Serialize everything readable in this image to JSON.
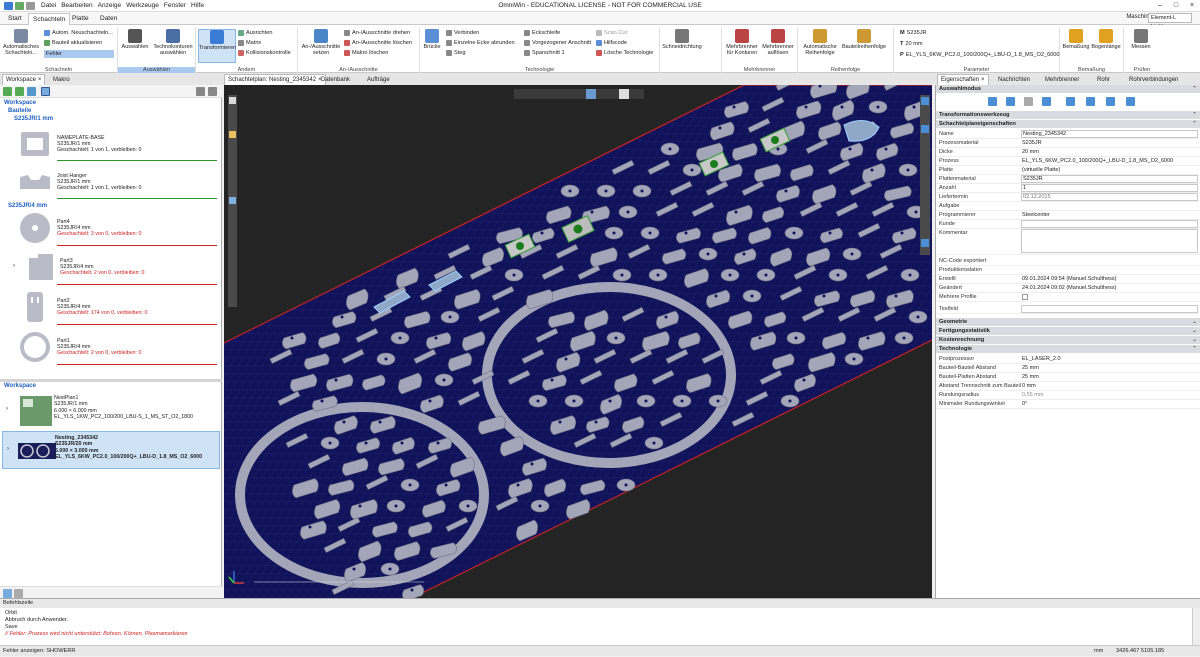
{
  "title_bar": {
    "menu": [
      "Datei",
      "Bearbeiten",
      "Anzeige",
      "Werkzeuge",
      "Fenster",
      "Hilfe"
    ],
    "title": "OmniWin - EDUCATIONAL LICENSE - NOT FOR COMMERCIAL USE",
    "controls": [
      "–",
      "□",
      "×"
    ]
  },
  "ribbon_tabs": [
    "Start",
    "Schachteln",
    "Platte",
    "Daten"
  ],
  "machine": {
    "label": "Maschine",
    "value": "Element-L Liebherr"
  },
  "ribbon": {
    "schachteln": {
      "big": "Automatisches Schachteln...",
      "items": [
        "Autom. Neuschachteln...",
        "Bauteil aktualisieren",
        "Fehler"
      ],
      "group": "Schachteln"
    },
    "auswahl": {
      "auswaehlen": "Auswählen",
      "technokonturen": "Technokonturen auswählen",
      "group": "Auswählen"
    },
    "aendern": {
      "transformieren": "Transformieren",
      "items": [
        "Ausrichten",
        "Matrix",
        "Kollisionskontrolle"
      ],
      "group": "Ändern"
    },
    "ausschnitte": {
      "big": "An-/Ausschnitte setzen",
      "items": [
        "An-/Ausschnitte drehen",
        "An-/Ausschnitte löschen",
        "Makro löschen"
      ],
      "group": "An-/Ausschnitte"
    },
    "technologie": {
      "bruecke": "Brücke",
      "items1": [
        "Verbinden",
        "Einzelne Ecke abrunden",
        "Steg"
      ],
      "items2": [
        "Eckschleife",
        "Vorgezogener Anschnitt",
        "Sparschnitt 1"
      ],
      "items3": [
        "Scan Cut",
        "Hilfscode",
        "Lösche Technologie"
      ],
      "group": "Technologie"
    },
    "schneidrichtung": "Schneidrichtung",
    "mehrbrenner": {
      "a": "Mehrbrenner für Konturen",
      "b": "Mehrbrenner auflösen",
      "group": "Mehrbrenner"
    },
    "reihenfolge": {
      "a": "Automatische Reihenfolge",
      "b": "Bauteilreihenfolge",
      "group": "Reihenfolge"
    },
    "parameter": {
      "M": "S235JR",
      "T": "20 mm",
      "P": "EL_YLS_6KW_PC2.0_100/200Q+_LBU-D_1.8_MS_O2_6000",
      "group": "Parameter"
    },
    "bemassung": {
      "a": "Bemaßung",
      "b": "Bogenlänge",
      "group": "Bemaßung"
    },
    "pruefen": {
      "a": "Messen",
      "group": "Prüfen"
    }
  },
  "dock_tabs_left": [
    "Workspace",
    "Makro"
  ],
  "dock_tabs_center": [
    "Schachtelplan: Nesting_2345342",
    "Datenbank",
    "Aufträge"
  ],
  "dock_tabs_right": [
    "Eigenschaften",
    "Nachrichten",
    "Mehrbrenner",
    "Rohr",
    "Rohrverbindungen"
  ],
  "left_panel": {
    "workspace": "Workspace",
    "bauteile": "Bauteile",
    "groups": [
      {
        "name": "S235JR/1 mm",
        "parts": [
          {
            "name": "NAMEPLATE-BASE",
            "material": "S235JR/1 mm",
            "status": "Geschachtelt: 1 von 1, verbleiben: 0",
            "color": "#2a9a2a"
          },
          {
            "name": "Joist Hanger",
            "material": "S235JR/1 mm",
            "status": "Geschachtelt: 1 von 1, verbleiben: 0",
            "color": "#2a9a2a"
          }
        ]
      },
      {
        "name": "S235JR/4 mm",
        "parts": [
          {
            "name": "Part4",
            "material": "S235JR/4 mm",
            "status": "Geschachtelt: 3 von 0, verbleiben: 0",
            "color": "#cc2222"
          },
          {
            "name": "Part3",
            "material": "S235JR/4 mm",
            "status": "Geschachtelt: 2 von 0, verbleiben: 0",
            "color": "#cc2222"
          },
          {
            "name": "Part2",
            "material": "S235JR/4 mm",
            "status": "Geschachtelt: 174 von 0, verbleiben: 0",
            "color": "#cc2222"
          },
          {
            "name": "Part1",
            "material": "S235JR/4 mm",
            "status": "Geschachtelt: 2 von 0, verbleiben: 0",
            "color": "#cc2222"
          }
        ]
      }
    ],
    "workspace2": "Workspace",
    "nests": [
      {
        "name": "NestPlan1",
        "mat": "S235JR/1 mm",
        "size": "6.000 × 6.000 mm",
        "proc": "EL_YLS_1KW_PC2_100/200_LBU-S_1_MS_ST_O2_1800"
      },
      {
        "name": "Nesting_2345342",
        "mat": "S235JR/20 mm",
        "size": "6.000 × 3.000 mm",
        "proc": "EL_YLS_6KW_PC2.0_100/200Q+_LBU-D_1.8_MS_O2_6000"
      }
    ]
  },
  "properties": {
    "auswahlmodus": "Auswahlmodus",
    "sections": [
      "Transformationswerkzeug",
      "Schachtelplaneigenschaften"
    ],
    "rows": [
      {
        "k": "Name",
        "v": "Nesting_2345342"
      },
      {
        "k": "Prozessmaterial",
        "v": "S235JR"
      },
      {
        "k": "Dicke",
        "v": "20 mm"
      },
      {
        "k": "Prozess",
        "v": "EL_YLS_6KW_PC2.0_100/200Q+_LBU-D_1.8_MS_O2_6000"
      },
      {
        "k": "Platte",
        "v": "(virtuelle Platte)"
      },
      {
        "k": "Plattenmaterial",
        "v": "S235JR"
      },
      {
        "k": "Anzahl",
        "v": "1"
      },
      {
        "k": "Liefertermin",
        "v": "02.12.2015"
      },
      {
        "k": "Aufgabe",
        "v": ""
      },
      {
        "k": "Programmierer",
        "v": "Steelcenter"
      },
      {
        "k": "Kunde",
        "v": ""
      },
      {
        "k": "Kommentar",
        "v": ""
      },
      {
        "k": "NC-Code exportiert",
        "v": ""
      },
      {
        "k": "Produktionsdaten",
        "v": ""
      },
      {
        "k": "Erstellt",
        "v": "09.01.2024 09:54 (Manuel.Schulthess)"
      },
      {
        "k": "Geändert",
        "v": "24.01.2024 09:02 (Manuel.Schulthess)"
      },
      {
        "k": "Mehrere Profile",
        "v": ""
      },
      {
        "k": "Testfeld",
        "v": ""
      }
    ],
    "sections2": [
      "Geometrie",
      "Fertigungsstatistik",
      "Kostenrechnung",
      "Technologie"
    ],
    "tech_rows": [
      {
        "k": "Postprozessor",
        "v": "EL_LASER_2.0"
      },
      {
        "k": "Bauteil-Bauteil Abstand",
        "v": "25 mm"
      },
      {
        "k": "Bauteil-Platten Abstand",
        "v": "25 mm"
      },
      {
        "k": "Abstand Trennschnitt zum Bauteil",
        "v": "0 mm"
      },
      {
        "k": "Rundungsradius",
        "v": "0,55 mm"
      },
      {
        "k": "Minimaler Rundungswinkel",
        "v": "0°"
      }
    ]
  },
  "command": {
    "header": "Befehlszeile",
    "lines": [
      "Orbit",
      "Abbruch durch Anwender.",
      "Save",
      "// Fehler: Prozess wird nicht unterstützt: Bohren, Körnen, Plasmamarkieren"
    ]
  },
  "status": {
    "left": "Fehler anzeigen: SHOWERR",
    "unit": "mm",
    "coords": "3426.467  5105.185"
  },
  "colors": {
    "accent": "#1f5fbf",
    "sheet": "#0f1150",
    "part": "#a3a6b8",
    "sheet_border": "#cc2222"
  }
}
